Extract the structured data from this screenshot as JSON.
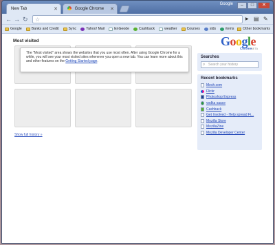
{
  "window": {
    "app_label": "Google"
  },
  "tabs": [
    {
      "label": "New Tab",
      "active": true
    },
    {
      "label": "Google Chrome",
      "active": false
    }
  ],
  "toolbar": {
    "url_value": "",
    "back_icon": "back-arrow",
    "forward_icon": "forward-arrow",
    "reload_icon": "reload"
  },
  "bookmarks_bar": {
    "items": [
      {
        "label": "Google",
        "icon": "folder"
      },
      {
        "label": "Banks and Credit",
        "icon": "folder"
      },
      {
        "label": "Sync",
        "icon": "folder"
      },
      {
        "label": "Yahoo! Mail",
        "icon": "favicon"
      },
      {
        "label": "EnGeode",
        "icon": "page"
      },
      {
        "label": "Cashback",
        "icon": "favicon"
      },
      {
        "label": "weather",
        "icon": "page"
      },
      {
        "label": "Courses",
        "icon": "folder"
      },
      {
        "label": "slds",
        "icon": "favicon"
      },
      {
        "label": "items",
        "icon": "favicon"
      }
    ],
    "other_label": "Other bookmarks"
  },
  "main": {
    "most_visited_title": "Most visited",
    "notice_text": "The \"Most visited\" area shows the websites that you use most often. After using Google Chrome for a while, you will see your most visited sites whenever you open a new tab. You can learn more about this and other features on the ",
    "notice_link": "Getting Started page",
    "notice_end": ".",
    "show_thumbnails": "Show full history »"
  },
  "logo": {
    "letters": [
      "G",
      "o",
      "o",
      "g",
      "l",
      "e"
    ],
    "colors": [
      "#3162c8",
      "#d8402c",
      "#f1b602",
      "#3162c8",
      "#3a9a3a",
      "#d8402c"
    ],
    "sub": "Chrome",
    "sub2": "BETA"
  },
  "searches": {
    "title": "Searches",
    "placeholder": "Search your history"
  },
  "recent_bookmarks": {
    "title": "Recent bookmarks",
    "items": [
      {
        "label": "Mesh.com",
        "icon": "page"
      },
      {
        "label": "Flickr",
        "icon": "flickr"
      },
      {
        "label": "Photoshop Express",
        "icon": "photoshop"
      },
      {
        "label": "vodka sauce",
        "icon": "green-dot"
      },
      {
        "label": "Cashback",
        "icon": "cashback"
      },
      {
        "label": "Get Involved - Help spread Fi...",
        "icon": "page"
      },
      {
        "label": "Mozilla Store",
        "icon": "page"
      },
      {
        "label": "MozillaZine",
        "icon": "page"
      },
      {
        "label": "Mozilla Developer Center",
        "icon": "page"
      }
    ]
  }
}
